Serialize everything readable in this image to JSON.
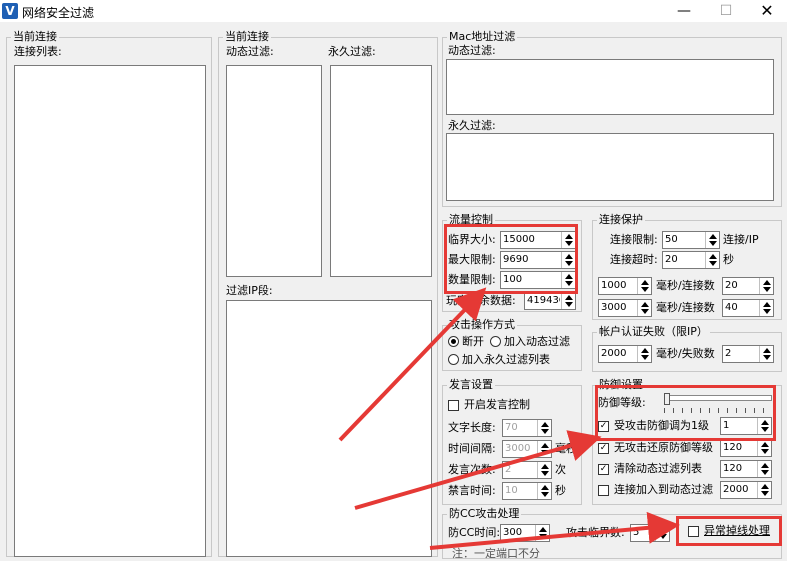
{
  "window": {
    "title": "网络安全过滤",
    "app_icon": "V",
    "minimize": "—",
    "maximize": "☐",
    "close": "✕"
  },
  "left_panel": {
    "title": "当前连接",
    "list_label": "连接列表:"
  },
  "middle_panel": {
    "title": "当前连接",
    "dynamic_label": "动态过滤:",
    "permanent_label": "永久过滤:",
    "ip_label": "过滤IP段:"
  },
  "mac_filter": {
    "title": "Mac地址过滤",
    "dynamic_label": "动态过滤:",
    "permanent_label": "永久过滤:"
  },
  "traffic": {
    "title": "流量控制",
    "threshold_label": "临界大小:",
    "threshold_value": "15000",
    "max_label": "最大限制:",
    "max_value": "9690",
    "count_label": "数量限制:",
    "count_value": "100",
    "remaining_label": "玩家剩余数据:",
    "remaining_value": "41943C"
  },
  "conn_protect": {
    "title": "连接保护",
    "limit_label": "连接限制:",
    "limit_value": "50",
    "limit_unit": "连接/IP",
    "timeout_label": "连接超时:",
    "timeout_value": "20",
    "timeout_unit": "秒",
    "rate1_ms": "1000",
    "rate1_label": "毫秒/连接数",
    "rate1_value": "20",
    "rate2_ms": "3000",
    "rate2_label": "毫秒/连接数",
    "rate2_value": "40"
  },
  "attack_mode": {
    "title": "攻击操作方式",
    "opt_disconnect": "断开",
    "opt_dynamic": "加入动态过滤",
    "opt_permanent": "加入永久过滤列表"
  },
  "auth_fail": {
    "title": "帐户认证失败（限IP）",
    "ms_value": "2000",
    "unit_label": "毫秒/失败数",
    "count_value": "2"
  },
  "speech": {
    "title": "发言设置",
    "enable_label": "开启发言控制",
    "length_label": "文字长度:",
    "length_value": "70",
    "interval_label": "时间间隔:",
    "interval_value": "3000",
    "interval_unit": "毫秒",
    "times_label": "发言次数:",
    "times_value": "2",
    "times_unit": "次",
    "ban_label": "禁言时间:",
    "ban_value": "10",
    "ban_unit": "秒"
  },
  "defense": {
    "title": "防御设置",
    "level_label": "防御等级:",
    "adjust_label": "受攻击防御调为1级",
    "adjust_value": "1",
    "restore_label": "无攻击还原防御等级",
    "restore_value": "120",
    "clear_label": "清除动态过滤列表",
    "clear_value": "120",
    "add_label": "连接加入到动态过滤",
    "add_value": "2000"
  },
  "cc": {
    "title": "防CC攻击处理",
    "time_label": "防CC时间:",
    "time_value": "300",
    "limit_label": "攻击临界数:",
    "limit_value": "5",
    "abnormal_label": "异常掉线处理",
    "footnote": "注：一定端口不分"
  },
  "colors": {
    "annotation": "#e53935",
    "window_bg": "#f0f0f0",
    "app_icon": "#1e5fb4"
  }
}
